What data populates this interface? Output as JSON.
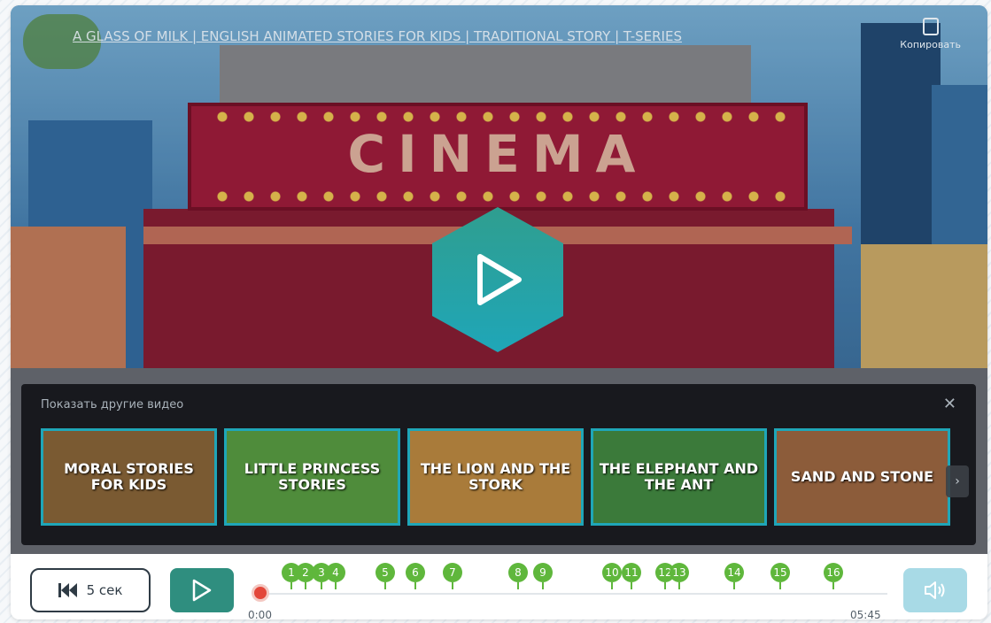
{
  "video": {
    "title": "A GLASS OF MILK | ENGLISH ANIMATED STORIES FOR KIDS | TRADITIONAL STORY | T-SERIES",
    "copy_label": "Копировать",
    "scene_sign": "CINEMA"
  },
  "suggestions": {
    "label": "Показать другие видео",
    "close": "✕",
    "next": "›",
    "items": [
      {
        "text": "MORAL STORIES FOR KIDS"
      },
      {
        "text": "LITTLE PRINCESS STORIES"
      },
      {
        "text": "THE LION AND THE STORK"
      },
      {
        "text": "THE ELEPHANT AND THE ANT"
      },
      {
        "text": "SAND AND STONE"
      }
    ]
  },
  "controls": {
    "back_label": "5 сек",
    "time_current": "0:00",
    "time_total": "05:45",
    "progress": 0,
    "markers": [
      "1",
      "2",
      "3",
      "4",
      "5",
      "6",
      "7",
      "8",
      "9",
      "10",
      "11",
      "12",
      "13",
      "14",
      "15",
      "16"
    ]
  },
  "colors": {
    "accent": "#2f8e7f",
    "marker": "#5fb73c",
    "knob": "#e3473a",
    "volume": "#a8dae6",
    "thumb_border": "#1fa6b8"
  }
}
